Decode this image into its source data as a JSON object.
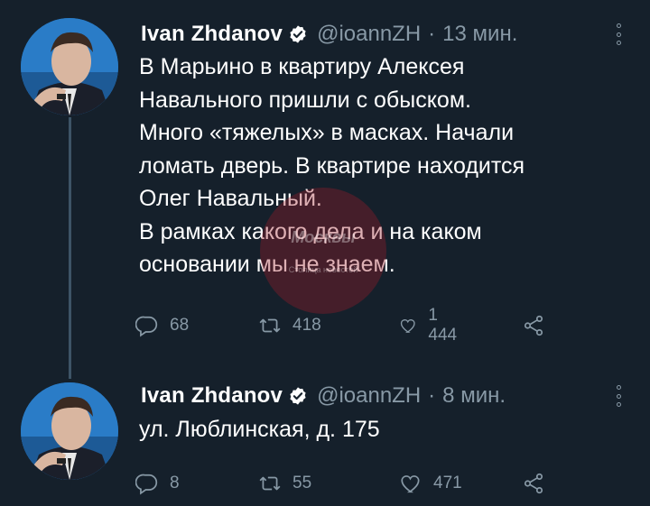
{
  "tweets": [
    {
      "author_name": "Ivan Zhdanov",
      "handle": "@ioannZH",
      "separator": "·",
      "time": "13 мин.",
      "text_lines": [
        "В Марьино в квартиру Алексея",
        "Навального пришли с обыском.",
        "Много «тяжелых» в масках. Начали",
        "ломать дверь.  В квартире находится",
        "Олег Навальный.",
        "В рамках какого дела и на каком",
        "основании мы не знаем."
      ],
      "replies": "68",
      "retweets": "418",
      "likes": "1 444"
    },
    {
      "author_name": "Ivan Zhdanov",
      "handle": "@ioannZH",
      "separator": "·",
      "time": "8 мин.",
      "text_lines": [
        "ул. Люблинская, д. 175"
      ],
      "replies": "8",
      "retweets": "55",
      "likes": "471"
    }
  ],
  "watermark": {
    "text": "Москвы",
    "caption": "Столица новостей"
  },
  "colors": {
    "background": "#15202b",
    "muted": "#8899a6",
    "text": "#ffffff",
    "thread_line": "#3d5466"
  },
  "icons": [
    "verified-badge-icon",
    "more-options-icon",
    "reply-icon",
    "retweet-icon",
    "like-icon",
    "share-icon"
  ]
}
